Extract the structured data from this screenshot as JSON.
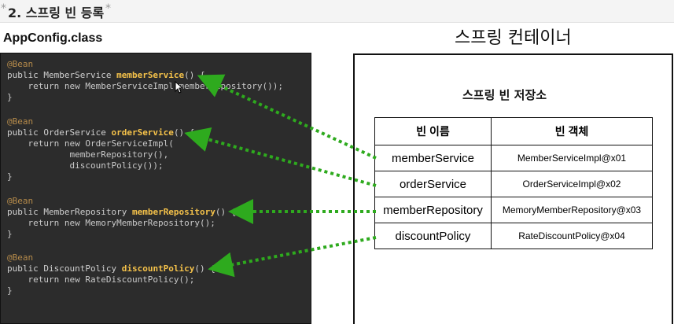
{
  "heading": {
    "text": "2. 스프링 빈 등록"
  },
  "config": {
    "title": "AppConfig.class",
    "blocks": [
      {
        "annotation": "@Bean",
        "prefix": "public MemberService ",
        "method": "memberService",
        "suffix": "() {",
        "body": [
          "    return new MemberServiceImpl(memberRepository());"
        ]
      },
      {
        "annotation": "@Bean",
        "prefix": "public OrderService ",
        "method": "orderService",
        "suffix": "() {",
        "body": [
          "    return new OrderServiceImpl(",
          "            memberRepository(),",
          "            discountPolicy());"
        ]
      },
      {
        "annotation": "@Bean",
        "prefix": "public MemberRepository ",
        "method": "memberRepository",
        "suffix": "() {",
        "body": [
          "    return new MemoryMemberRepository();"
        ]
      },
      {
        "annotation": "@Bean",
        "prefix": "public DiscountPolicy ",
        "method": "discountPolicy",
        "suffix": "() {",
        "body": [
          "    return new RateDiscountPolicy();"
        ]
      }
    ],
    "close": "}"
  },
  "container": {
    "title": "스프링 컨테이너",
    "store_title": "스프링 빈 저장소",
    "headers": [
      "빈 이름",
      "빈 객체"
    ],
    "rows": [
      {
        "name": "memberService",
        "object": "MemberServiceImpl@x01"
      },
      {
        "name": "orderService",
        "object": "OrderServiceImpl@x02"
      },
      {
        "name": "memberRepository",
        "object": "MemoryMemberRepository@x03"
      },
      {
        "name": "discountPolicy",
        "object": "RateDiscountPolicy@x04"
      }
    ]
  },
  "colors": {
    "arrow": "#2eaa1e",
    "code_bg": "#2c2c2c",
    "method": "#f5c24a",
    "annotation": "#b58a4a"
  }
}
